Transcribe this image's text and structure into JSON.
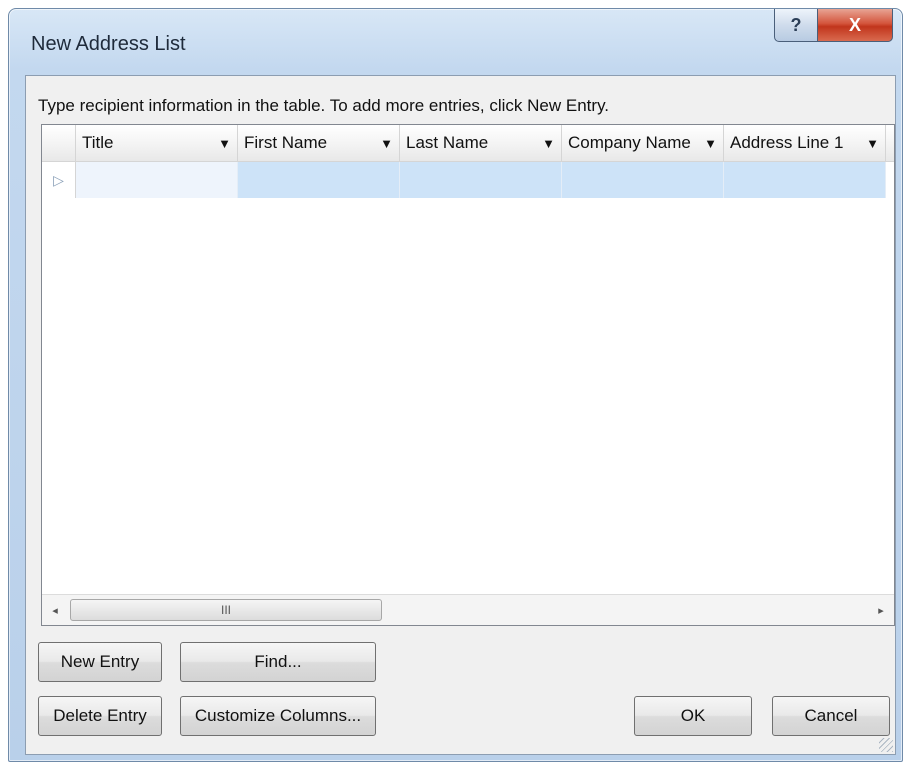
{
  "window": {
    "title": "New Address List",
    "help_label": "?",
    "close_label": "X"
  },
  "instructions": "Type recipient information in the table.  To add more entries, click New Entry.",
  "table": {
    "columns": [
      "Title",
      "First Name",
      "Last Name",
      "Company Name",
      "Address Line 1"
    ],
    "dropdown_glyph": "▼",
    "row_indicator": "▷",
    "rows": [
      [
        "",
        "",
        "",
        "",
        ""
      ]
    ]
  },
  "scrollbar": {
    "left_arrow": "◂",
    "right_arrow": "▸",
    "thumb_grip": "III"
  },
  "buttons": {
    "new_entry": "New Entry",
    "find": "Find...",
    "delete_entry": "Delete Entry",
    "customize_columns": "Customize Columns...",
    "ok": "OK",
    "cancel": "Cancel"
  }
}
